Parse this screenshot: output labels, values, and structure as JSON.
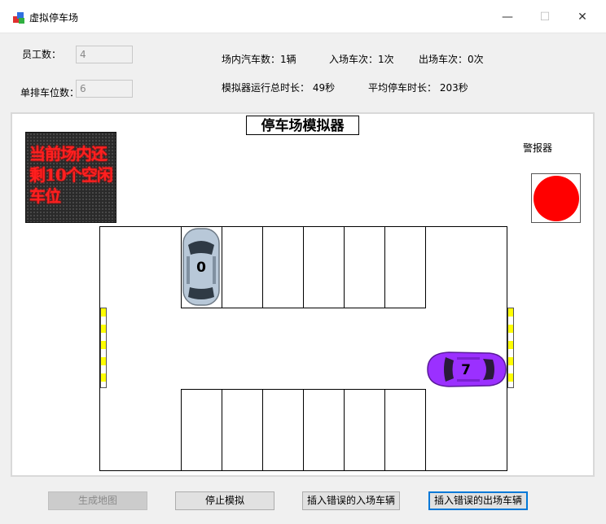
{
  "window": {
    "title": "虚拟停车场",
    "minimize_glyph": "—",
    "maximize_glyph": "☐",
    "close_glyph": "✕"
  },
  "form": {
    "employees_label": "员工数：",
    "employees_value": "4",
    "slots_per_row_label": "单排车位数：",
    "slots_per_row_value": "6"
  },
  "stats": {
    "cars_in_lot": "场内汽车数：1辆",
    "entries": "入场车次：1次",
    "exits": "出场车次：0次",
    "total_runtime": "模拟器运行总时长：  49秒",
    "avg_parking": "平均停车时长：  203秒"
  },
  "sim": {
    "title": "停车场模拟器",
    "led_text": "当前场内还剩10个空闲车位",
    "alarm_label": "警报器",
    "alarm_color": "#ff0000",
    "cars": [
      {
        "id": "0",
        "color": "#b8c8d8"
      },
      {
        "id": "7",
        "color": "#9b30ff"
      }
    ]
  },
  "buttons": {
    "generate_map": "生成地图",
    "stop_sim": "停止模拟",
    "insert_bad_entry": "插入错误的入场车辆",
    "insert_bad_exit": "插入错误的出场车辆"
  }
}
